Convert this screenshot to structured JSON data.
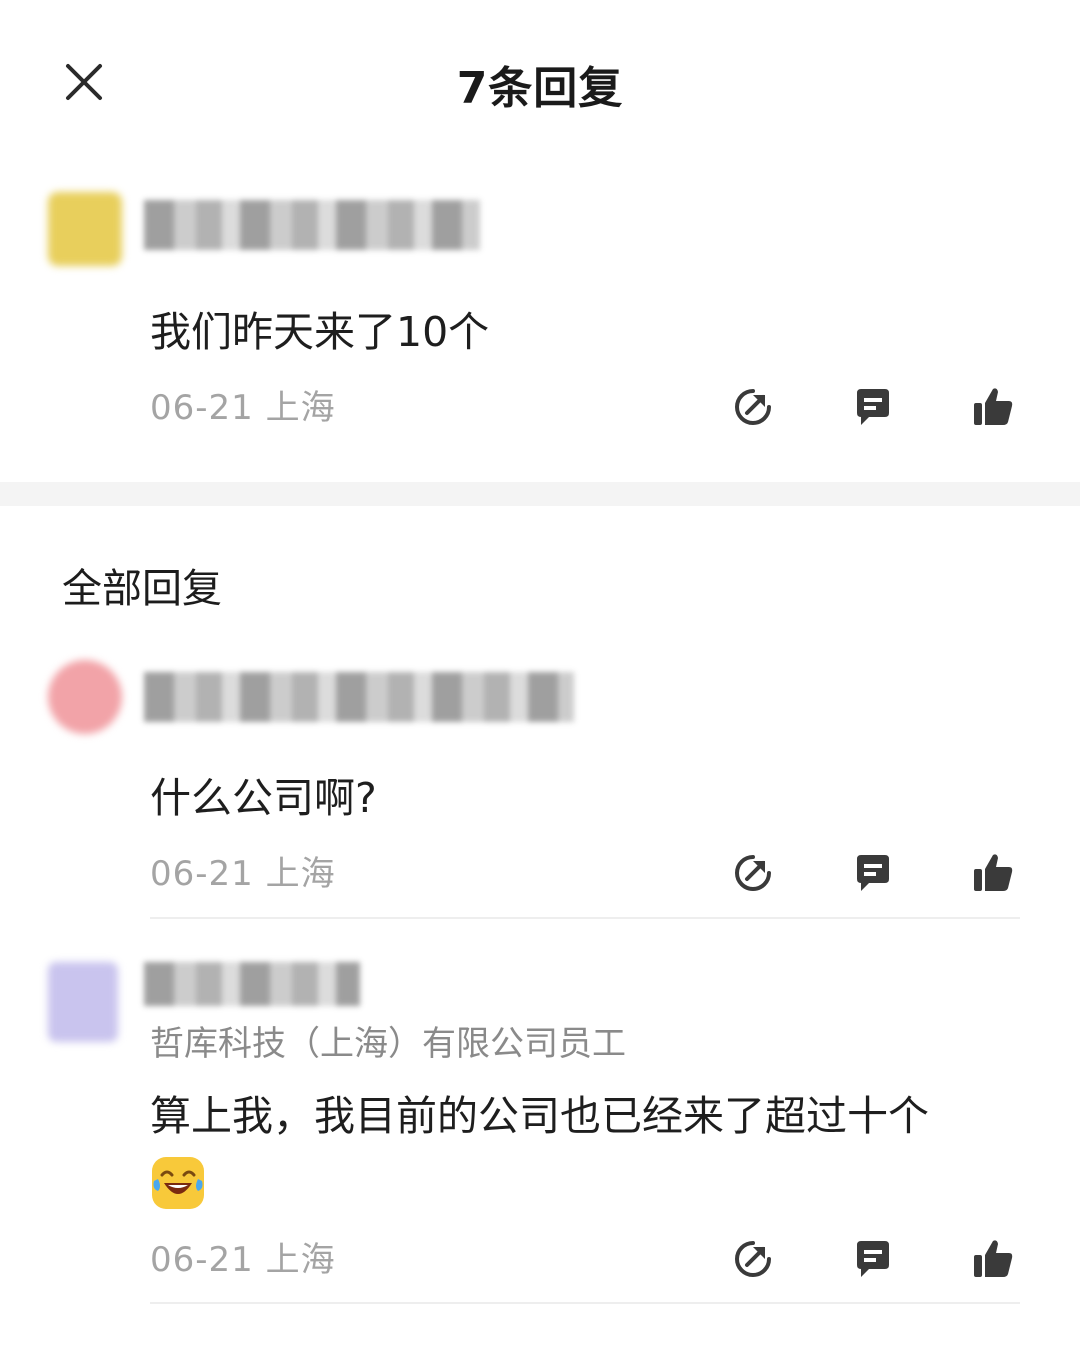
{
  "header": {
    "title": "7条回复",
    "close_icon": "close-icon"
  },
  "main_comment": {
    "avatar_color": "#e8cf5c",
    "content": "我们昨天来了10个",
    "meta": "06-21 上海",
    "actions": [
      "share-icon",
      "reply-icon",
      "like-icon"
    ]
  },
  "section": {
    "title": "全部回复"
  },
  "replies": [
    {
      "avatar_color": "#f2a3a8",
      "content": "什么公司啊?",
      "meta": "06-21 上海"
    },
    {
      "avatar_color": "#c9c4ee",
      "affiliation": "哲库科技（上海）有限公司员工",
      "content": "算上我，我目前的公司也已经来了超过十个",
      "emoji": "laughing-crying-emoji",
      "meta": "06-21 上海"
    }
  ],
  "colors": {
    "icon": "#333333",
    "meta_text": "#a4a4a4"
  }
}
